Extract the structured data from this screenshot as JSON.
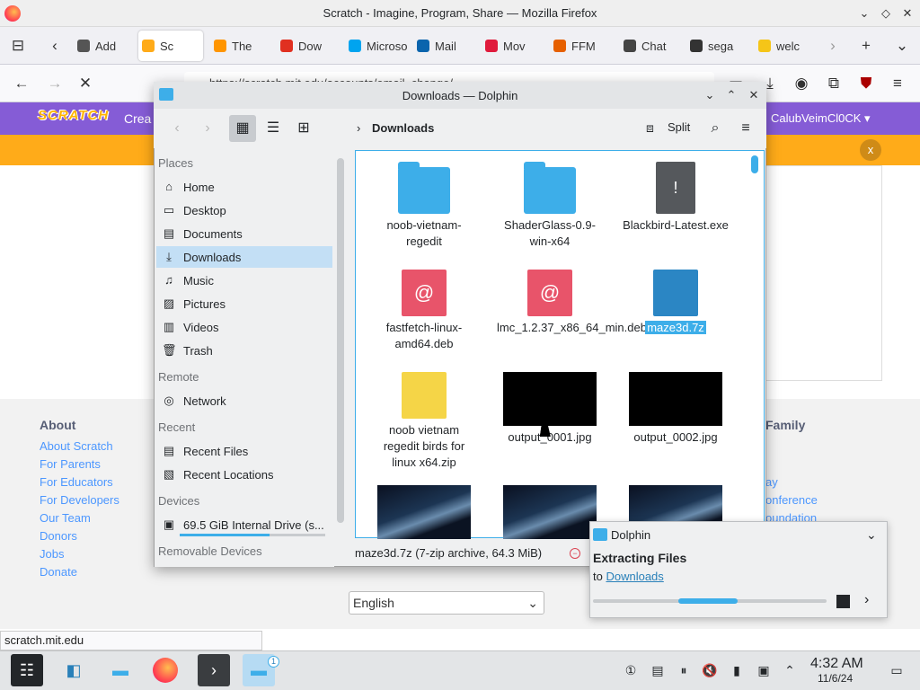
{
  "firefox": {
    "window_title": "Scratch - Imagine, Program, Share — Mozilla Firefox",
    "tabs": [
      {
        "label": "Add",
        "color": "#555555"
      },
      {
        "label": "Sc",
        "color": "#ffab19"
      },
      {
        "label": "The",
        "color": "#ff9500"
      },
      {
        "label": "Dow",
        "color": "#e03020"
      },
      {
        "label": "Microso",
        "color": "#00a4ef"
      },
      {
        "label": "Mail",
        "color": "#0a64ad"
      },
      {
        "label": "Mov",
        "color": "#e01b3c"
      },
      {
        "label": "FFM",
        "color": "#e66000"
      },
      {
        "label": "Chat",
        "color": "#444444"
      },
      {
        "label": "sega",
        "color": "#333333"
      },
      {
        "label": "welc",
        "color": "#f5c518"
      }
    ],
    "url": "https://scratch.mit.edu/accounts/email_change/",
    "status_url": "scratch.mit.edu"
  },
  "scratch": {
    "logo": "SCRATCH",
    "create_label": "Crea",
    "username": "CalubVeimCl0CK ▾",
    "banner_close": "x",
    "footer": {
      "about_heading": "About",
      "about_links": [
        "About Scratch",
        "For Parents",
        "For Educators",
        "For Developers",
        "Our Team",
        "Donors",
        "Jobs",
        "Donate"
      ],
      "family_heading": "Family",
      "family_links": [
        "ay",
        "onference",
        "oundation"
      ]
    },
    "language": "English"
  },
  "dolphin": {
    "title": "Downloads — Dolphin",
    "breadcrumb": "Downloads",
    "split_label": "Split",
    "places": {
      "places_heading": "Places",
      "places_items": [
        "Home",
        "Desktop",
        "Documents",
        "Downloads",
        "Music",
        "Pictures",
        "Videos",
        "Trash"
      ],
      "remote_heading": "Remote",
      "remote_items": [
        "Network"
      ],
      "recent_heading": "Recent",
      "recent_items": [
        "Recent Files",
        "Recent Locations"
      ],
      "devices_heading": "Devices",
      "devices_items": [
        "69.5 GiB Internal Drive (s..."
      ],
      "removable_heading": "Removable Devices"
    },
    "files": [
      {
        "name": "noob-vietnam-regedit",
        "kind": "folder"
      },
      {
        "name": "ShaderGlass-0.9-win-x64",
        "kind": "folder"
      },
      {
        "name": "Blackbird-Latest.exe",
        "kind": "exe"
      },
      {
        "name": "fastfetch-linux-amd64.deb",
        "kind": "deb"
      },
      {
        "name": "lmc_1.2.37_x86_64_min.deb",
        "kind": "deb"
      },
      {
        "name": "maze3d.7z",
        "kind": "7z"
      },
      {
        "name": "noob vietnam regedit birds for linux x64.zip",
        "kind": "zip"
      },
      {
        "name": "output_0001.jpg",
        "kind": "jpg"
      },
      {
        "name": "output_0002.jpg",
        "kind": "jpg"
      }
    ],
    "status_text": "maze3d.7z (7-zip archive, 64.3 MiB)"
  },
  "notification": {
    "app": "Dolphin",
    "title": "Extracting Files",
    "body_prefix": "to ",
    "link": "Downloads",
    "progress": 0.55
  },
  "taskbar": {
    "time": "4:32 AM",
    "date": "11/6/24",
    "dolphin_badge": "1"
  }
}
